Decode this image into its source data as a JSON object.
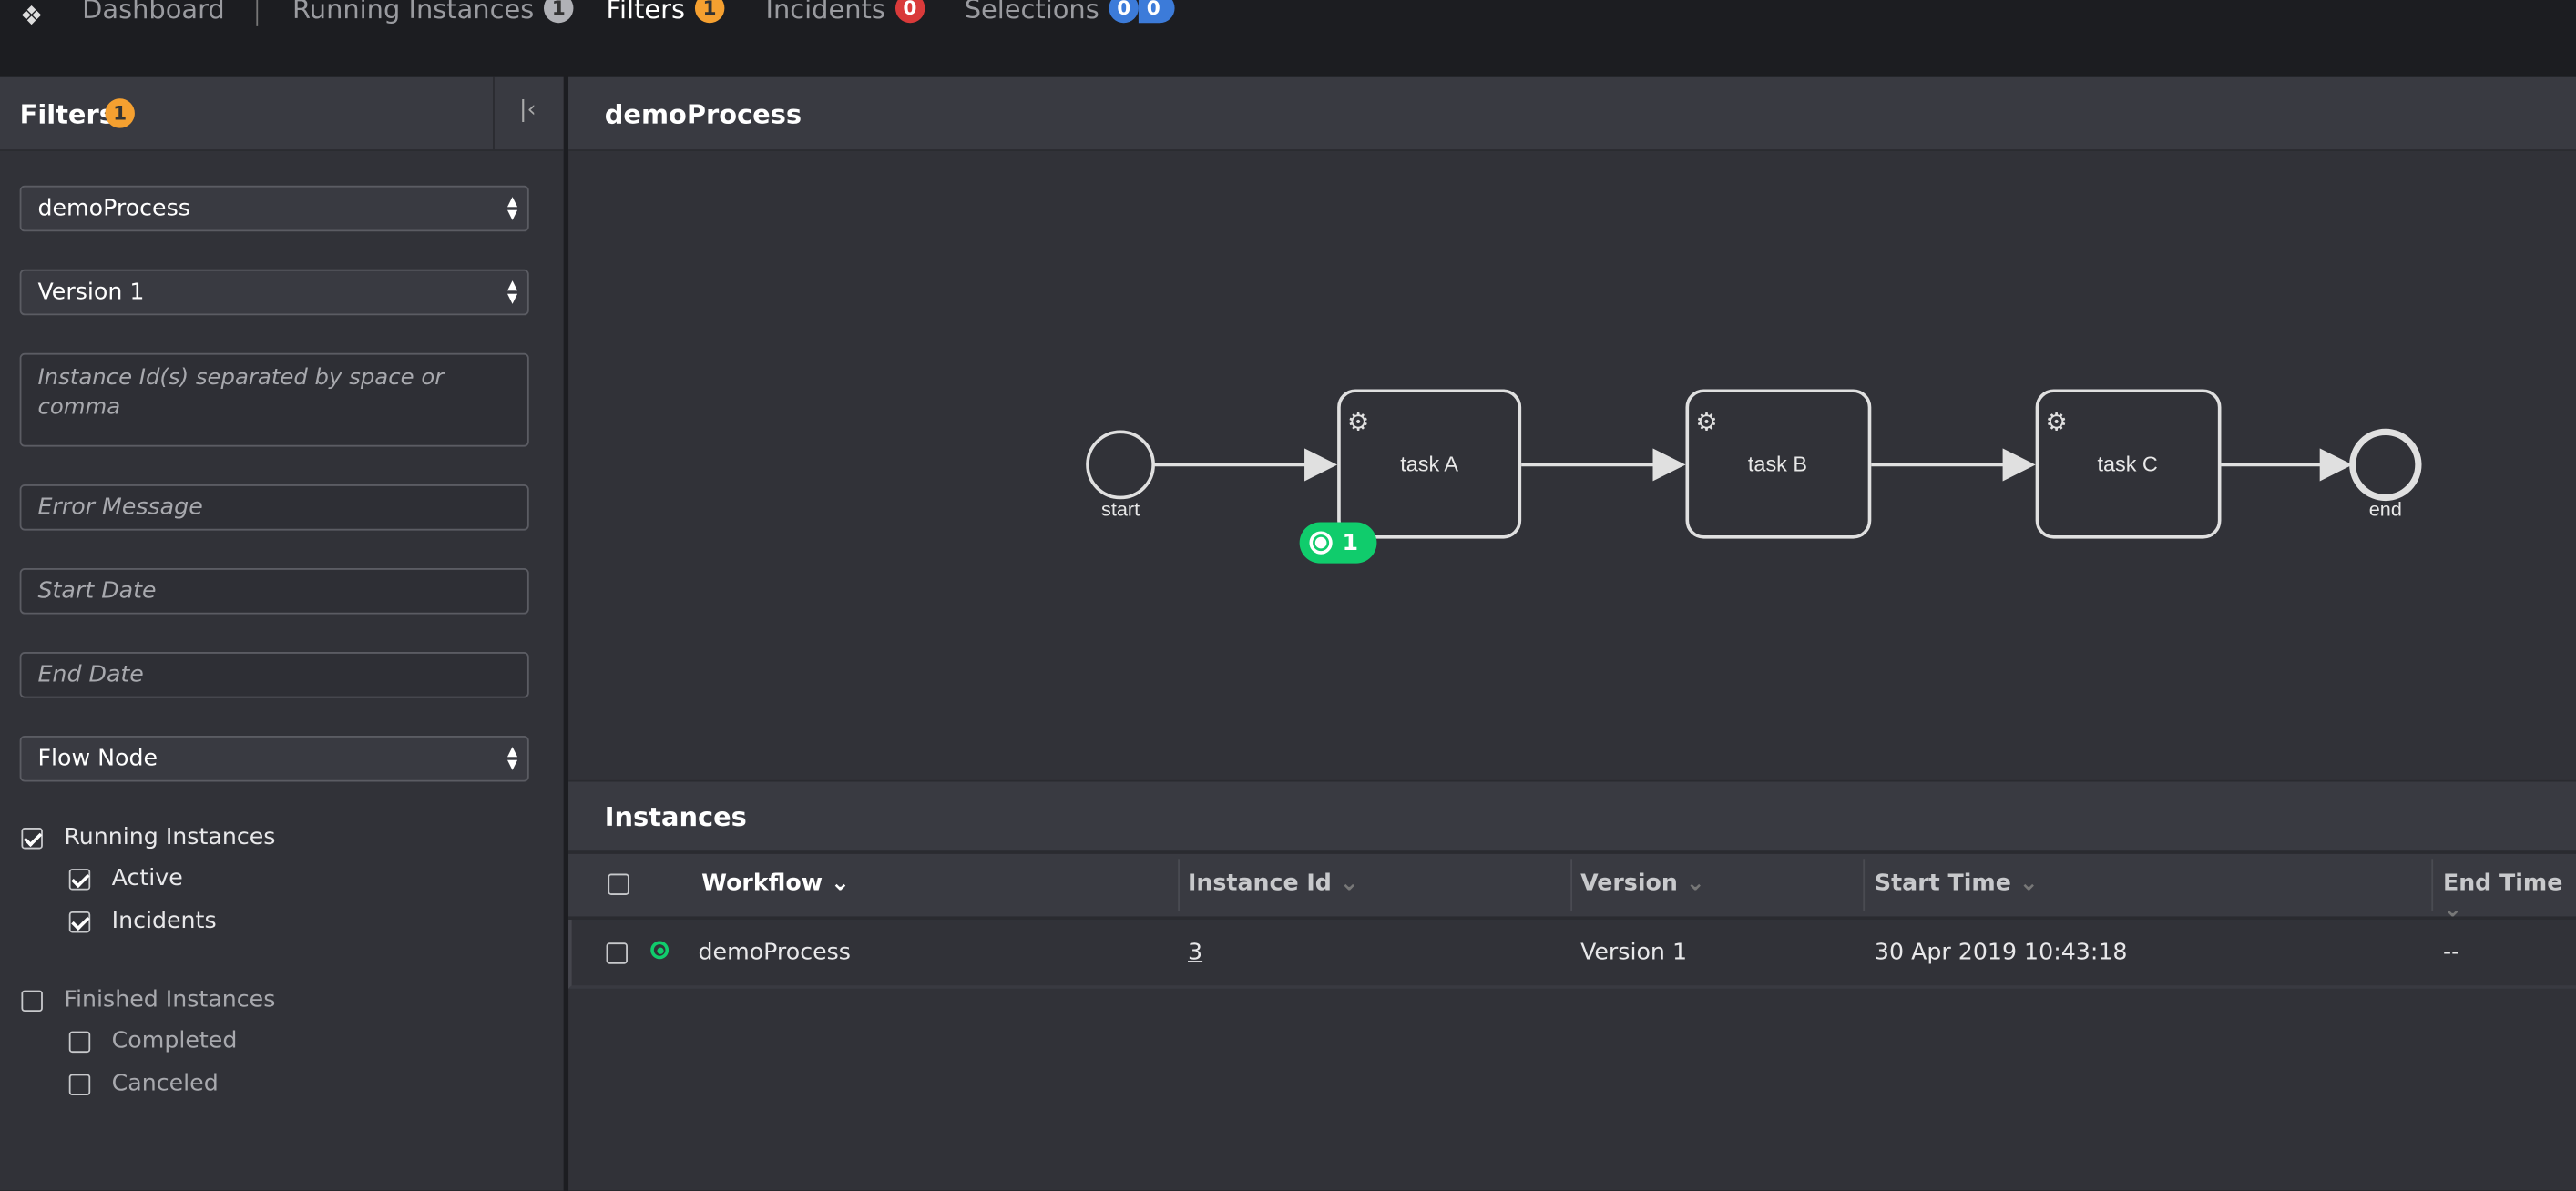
{
  "nav": {
    "items": [
      {
        "label": "Dashboard"
      },
      {
        "label": "Running Instances",
        "count": "1",
        "color": "#b0b1b6"
      },
      {
        "label": "Filters",
        "count": "1",
        "color": "#f5a030"
      },
      {
        "label": "Incidents",
        "count": "0",
        "color": "#d93a3a"
      },
      {
        "label": "Selections",
        "count": "0",
        "count2": "0",
        "color": "#3c7bd9"
      }
    ]
  },
  "filters": {
    "title": "Filters",
    "count": "1",
    "workflow": "demoProcess",
    "version": "Version 1",
    "instance_ids_placeholder": "Instance Id(s) separated by space or comma",
    "error_placeholder": "Error Message",
    "start_placeholder": "Start Date",
    "end_placeholder": "End Date",
    "flow_node": "Flow Node",
    "running": "Running Instances",
    "active": "Active",
    "incidents": "Incidents",
    "finished": "Finished Instances",
    "completed": "Completed",
    "canceled": "Canceled"
  },
  "diagram": {
    "title": "demoProcess",
    "start": "start",
    "end": "end",
    "tasks": [
      "task A",
      "task B",
      "task C"
    ],
    "active_badge": "1",
    "badge_color": "#10cc6c"
  },
  "instances": {
    "title": "Instances",
    "columns": [
      "Workflow",
      "Instance Id",
      "Version",
      "Start Time",
      "End Time"
    ],
    "rows": [
      {
        "workflow": "demoProcess",
        "id": "3",
        "version": "Version 1",
        "start": "30 Apr 2019 10:43:18",
        "end": "--",
        "state": "active"
      }
    ]
  }
}
